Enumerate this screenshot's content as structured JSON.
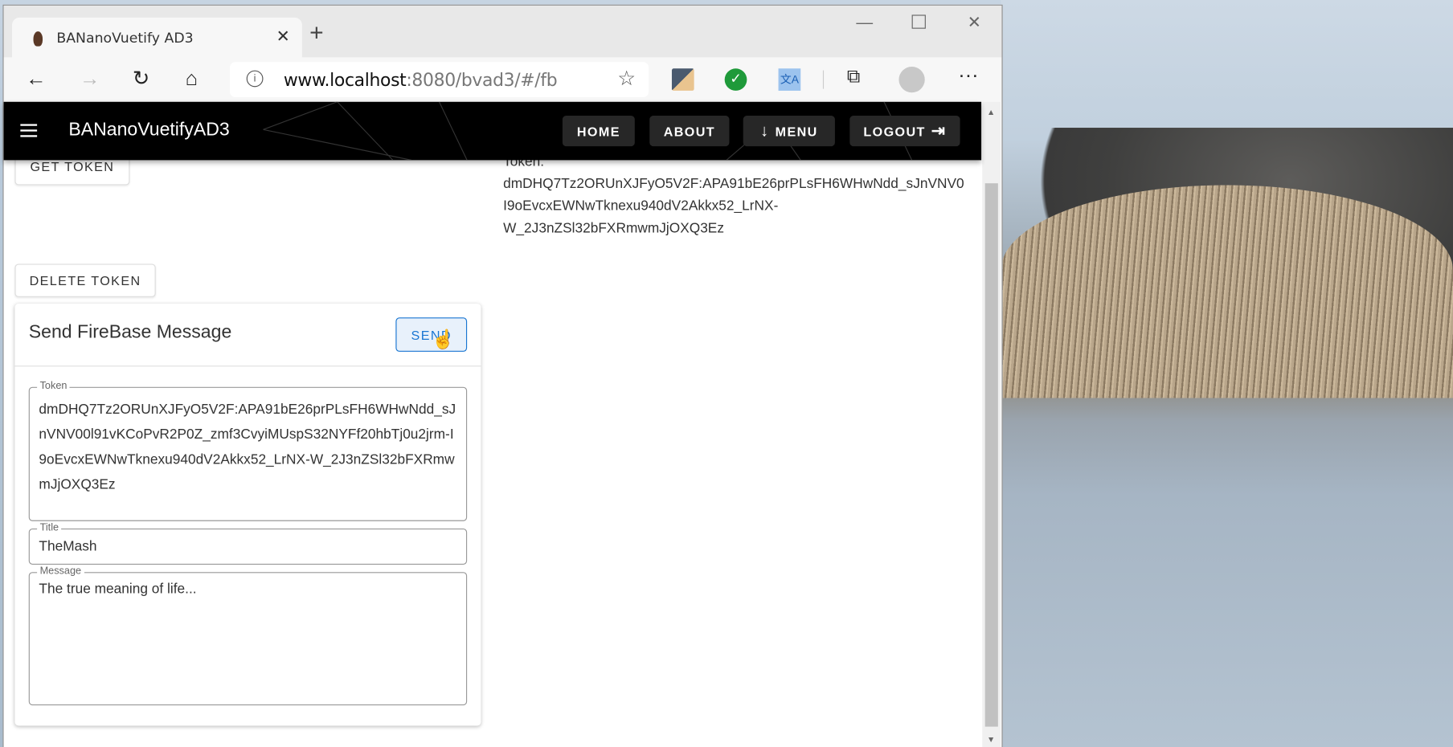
{
  "browser": {
    "tab_title": "BANanoVuetify AD3",
    "url_host": "www.localhost",
    "url_rest": ":8080/bvad3/#/fb"
  },
  "appbar": {
    "title": "BANanoVuetifyAD3",
    "nav": [
      "HOME",
      "ABOUT",
      "MENU",
      "LOGOUT"
    ]
  },
  "page": {
    "get_token_label": "GET TOKEN",
    "delete_token_label": "DELETE TOKEN",
    "token_heading": "Token:",
    "token_lines": [
      "dmDHQ7Tz2ORUnXJFyO5V2F:APA91bE26prPLsFH6WHwNdd_sJnVNV0",
      "I9oEvcxEWNwTknexu940dV2Akkx52_LrNX-",
      "W_2J3nZSl32bFXRmwmJjOXQ3Ez"
    ]
  },
  "card": {
    "title": "Send FireBase Message",
    "send_label": "SEND",
    "token_label": "Token",
    "token_value": "dmDHQ7Tz2ORUnXJFyO5V2F:APA91bE26prPLsFH6WHwNdd_sJnVNV00l91vKCoPvR2P0Z_zmf3CvyiMUspS32NYFf20hbTj0u2jrm-I9oEvcxEWNwTknexu940dV2Akkx52_LrNX-W_2J3nZSl32bFXRmwmJjOXQ3Ez",
    "title_label": "Title",
    "title_value": "TheMash",
    "message_label": "Message",
    "message_value": "The true meaning of life..."
  },
  "colors": {
    "accent": "#1976d2",
    "appbar": "#000000"
  }
}
